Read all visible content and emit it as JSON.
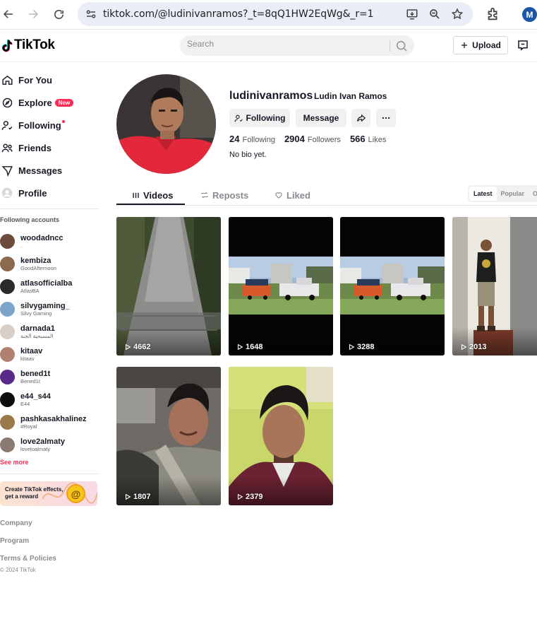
{
  "browser": {
    "url": "tiktok.com/@ludinivanramos?_t=8qQ1HW2EqWg&_r=1",
    "profile_initial": "M"
  },
  "header": {
    "logo": "TikTok",
    "search_placeholder": "Search",
    "upload_label": "Upload"
  },
  "sidebar": {
    "nav": [
      {
        "label": "For You",
        "icon": "home-icon"
      },
      {
        "label": "Explore",
        "icon": "compass-icon",
        "badge": "New"
      },
      {
        "label": "Following",
        "icon": "following-icon"
      },
      {
        "label": "Friends",
        "icon": "friends-icon"
      },
      {
        "label": "Messages",
        "icon": "messages-icon"
      },
      {
        "label": "Profile",
        "icon": "profile-icon"
      }
    ],
    "following_title": "Following accounts",
    "accounts": [
      {
        "username": "woodadncc",
        "nickname": ".",
        "color": "#6b4b3a"
      },
      {
        "username": "kembiza",
        "nickname": "GoodAfternoon",
        "color": "#8b6a4d"
      },
      {
        "username": "atlasofficialba",
        "nickname": "AtlasBA",
        "color": "#2a2a2a"
      },
      {
        "username": "silvygaming_",
        "nickname": "Silvy Gaming",
        "color": "#7da4c9"
      },
      {
        "username": "darnada1",
        "nickname": "المسيحية الجنة",
        "color": "#d8d0c8"
      },
      {
        "username": "kitaav",
        "nickname": "kitaav",
        "color": "#b08070"
      },
      {
        "username": "bened1t",
        "nickname": "Bened1t",
        "color": "#5a2a8a"
      },
      {
        "username": "e44_s44",
        "nickname": "E44",
        "color": "#0d0d0d"
      },
      {
        "username": "pashkasakhalinez",
        "nickname": "#Royal",
        "color": "#9a7a4a"
      },
      {
        "username": "love2almaty",
        "nickname": "lovetoalmaty",
        "color": "#8a7a70"
      }
    ],
    "see_more": "See more",
    "effects_banner": "Create TikTok effects, get a reward",
    "footer": [
      "Company",
      "Program",
      "Terms & Policies"
    ],
    "copyright": "© 2024 TikTok"
  },
  "profile": {
    "username": "ludinivanramos",
    "nickname": "Ludin Ivan Ramos",
    "following_button": "Following",
    "message_button": "Message",
    "following_count": "24",
    "following_label": "Following",
    "followers_count": "2904",
    "followers_label": "Followers",
    "likes_count": "566",
    "likes_label": "Likes",
    "bio": "No bio yet."
  },
  "tabs": {
    "items": [
      "Videos",
      "Reposts",
      "Liked"
    ],
    "active": "Videos",
    "sort": [
      "Latest",
      "Popular",
      "Oldest"
    ],
    "active_sort": "Latest"
  },
  "videos": [
    {
      "views": "4662",
      "thumb": "walkway"
    },
    {
      "views": "1648",
      "thumb": "truck"
    },
    {
      "views": "3288",
      "thumb": "truck"
    },
    {
      "views": "2013",
      "thumb": "doorway"
    },
    {
      "views": "1807",
      "thumb": "car-selfie"
    },
    {
      "views": "2379",
      "thumb": "selfie"
    }
  ]
}
